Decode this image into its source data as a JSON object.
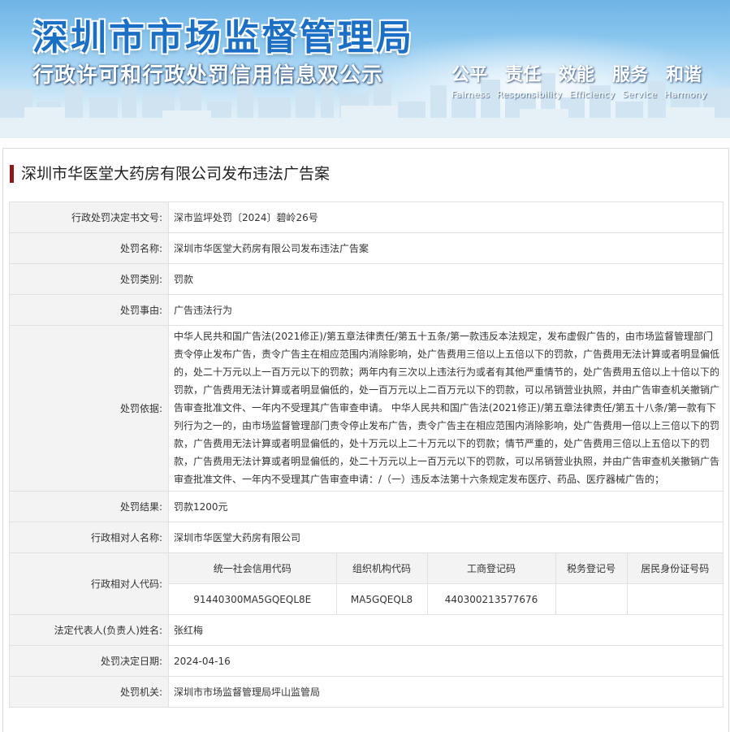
{
  "banner": {
    "title": "深圳市市场监督管理局",
    "subtitle": "行政许可和行政处罚信用信息双公示",
    "slogans": [
      {
        "cn": "公平",
        "en": "Fairness"
      },
      {
        "cn": "责任",
        "en": "Responsibility"
      },
      {
        "cn": "效能",
        "en": "Efficiency"
      },
      {
        "cn": "服务",
        "en": "Service"
      },
      {
        "cn": "和谐",
        "en": "Harmony"
      }
    ]
  },
  "case_title": "深圳市华医堂大药房有限公司发布违法广告案",
  "fields": {
    "doc_no": {
      "label": "行政处罚决定书文号:",
      "value": "深市监坪处罚〔2024〕碧岭26号"
    },
    "name": {
      "label": "处罚名称:",
      "value": "深圳市华医堂大药房有限公司发布违法广告案"
    },
    "category": {
      "label": "处罚类别:",
      "value": "罚款"
    },
    "reason": {
      "label": "处罚事由:",
      "value": "广告违法行为"
    },
    "basis": {
      "label": "处罚依据:",
      "value": "中华人民共和国广告法(2021修正)/第五章法律责任/第五十五条/第一款违反本法规定，发布虚假广告的，由市场监督管理部门责令停止发布广告，责令广告主在相应范围内消除影响，处广告费用三倍以上五倍以下的罚款，广告费用无法计算或者明显偏低的，处二十万元以上一百万元以下的罚款；两年内有三次以上违法行为或者有其他严重情节的，处广告费用五倍以上十倍以下的罚款，广告费用无法计算或者明显偏低的，处一百万元以上二百万元以下的罚款，可以吊销营业执照，并由广告审查机关撤销广告审查批准文件、一年内不受理其广告审查申请。 中华人民共和国广告法(2021修正)/第五章法律责任/第五十八条/第一款有下列行为之一的，由市场监督管理部门责令停止发布广告，责令广告主在相应范围内消除影响，处广告费用一倍以上三倍以下的罚款，广告费用无法计算或者明显偏低的，处十万元以上二十万元以下的罚款；情节严重的，处广告费用三倍以上五倍以下的罚款，广告费用无法计算或者明显偏低的，处二十万元以上一百万元以下的罚款，可以吊销营业执照，并由广告审查机关撤销广告审查批准文件、一年内不受理其广告审查申请：/（一）违反本法第十六条规定发布医疗、药品、医疗器械广告的；"
    },
    "result": {
      "label": "处罚结果:",
      "value": "罚款1200元"
    },
    "party_name": {
      "label": "行政相对人名称:",
      "value": "深圳市华医堂大药房有限公司"
    },
    "party_code": {
      "label": "行政相对人代码:"
    },
    "legal_rep": {
      "label": "法定代表人(负责人)姓名:",
      "value": "张红梅"
    },
    "decision_date": {
      "label": "处罚决定日期:",
      "value": "2024-04-16"
    },
    "authority": {
      "label": "处罚机关:",
      "value": "深圳市市场监督管理局坪山监管局"
    }
  },
  "codes": {
    "headers": [
      "统一社会信用代码",
      "组织机构代码",
      "工商登记码",
      "税务登记号",
      "居民身份证号码"
    ],
    "values": [
      "91440300MA5GQEQL8E",
      "MA5GQEQL8",
      "440300213577676",
      "",
      ""
    ]
  }
}
